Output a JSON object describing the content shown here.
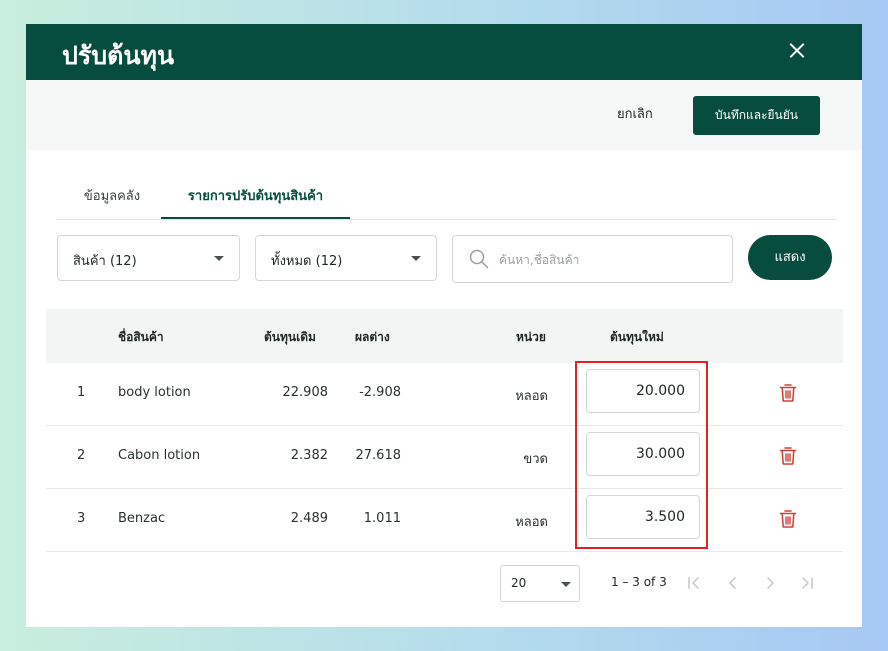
{
  "header": {
    "title": "ปรับต้นทุน",
    "close_icon": "close-icon"
  },
  "actions": {
    "cancel_label": "ยกเลิก",
    "save_label": "บันทึกและยืนยัน"
  },
  "tabs": [
    {
      "label": "ข้อมูลคลัง",
      "active": false
    },
    {
      "label": "รายการปรับต้นทุนสินค้า",
      "active": true
    }
  ],
  "filters": {
    "product_select": "สินค้า (12)",
    "status_select": "ทั้งหมด (12)",
    "search_placeholder": "ค้นหา,ชื่อสินค้า",
    "search_value": "",
    "show_label": "แสดง"
  },
  "table": {
    "headers": {
      "name": "ชื่อสินค้า",
      "old_cost": "ต้นทุนเดิม",
      "diff": "ผลต่าง",
      "unit": "หน่วย",
      "new_cost": "ต้นทุนใหม่"
    },
    "rows": [
      {
        "index": "1",
        "name": "body lotion",
        "old_cost": "22.908",
        "diff": "-2.908",
        "unit": "หลอด",
        "new_cost": "20.000"
      },
      {
        "index": "2",
        "name": "Cabon lotion",
        "old_cost": "2.382",
        "diff": "27.618",
        "unit": "ขวด",
        "new_cost": "30.000"
      },
      {
        "index": "3",
        "name": "Benzac",
        "old_cost": "2.489",
        "diff": "1.011",
        "unit": "หลอด",
        "new_cost": "3.500"
      }
    ]
  },
  "pagination": {
    "page_size": "20",
    "range": "1 – 3 of 3"
  },
  "colors": {
    "primary": "#064d3f",
    "danger": "#d0433a",
    "highlight": "#e02424"
  }
}
